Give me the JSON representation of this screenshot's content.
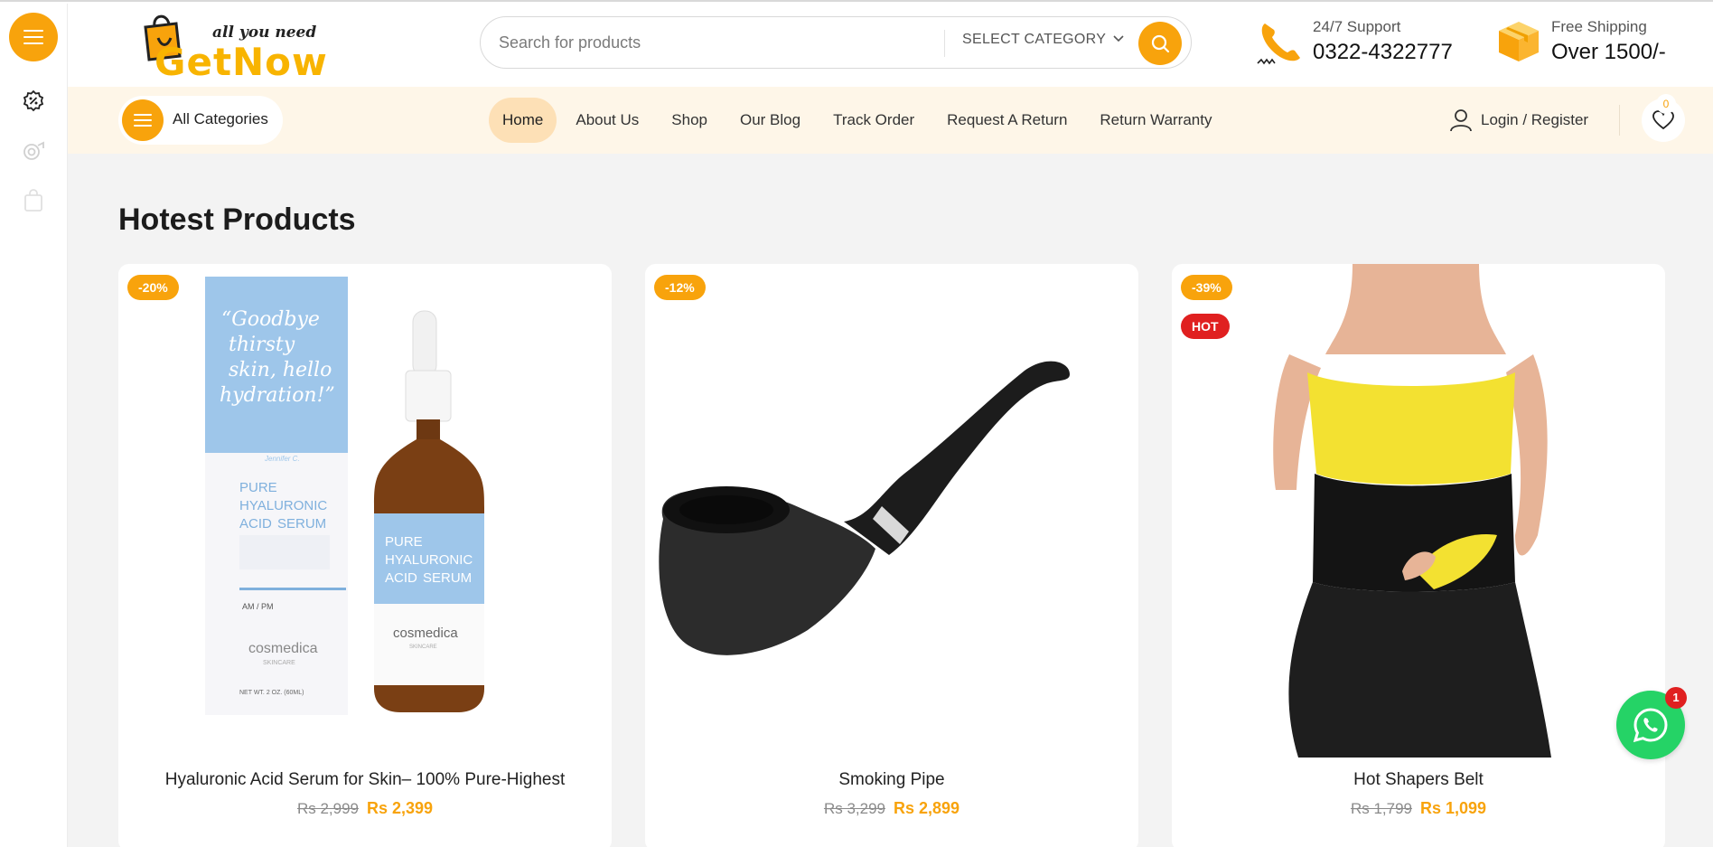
{
  "header": {
    "logo_tagline": "all you need",
    "logo_name": "GetNow",
    "search": {
      "placeholder": "Search for products",
      "category_label": "SELECT CATEGORY"
    },
    "support": {
      "label": "24/7 Support",
      "value": "0322-4322777"
    },
    "shipping": {
      "label": "Free Shipping",
      "value": "Over 1500/-"
    }
  },
  "navbar": {
    "all_categories_label": "All Categories",
    "items": [
      {
        "label": "Home",
        "active": true
      },
      {
        "label": "About Us"
      },
      {
        "label": "Shop"
      },
      {
        "label": "Our Blog"
      },
      {
        "label": "Track Order"
      },
      {
        "label": "Request A Return"
      },
      {
        "label": "Return Warranty"
      }
    ],
    "login_label": "Login / Register",
    "wishlist_count": "0"
  },
  "main": {
    "section_title": "Hotest Products",
    "products": [
      {
        "title": "Hyaluronic Acid Serum for Skin– 100% Pure-Highest",
        "old_price": "Rs 2,999",
        "new_price": "Rs 2,399",
        "discount": "-20%"
      },
      {
        "title": "Smoking Pipe",
        "old_price": "Rs 3,299",
        "new_price": "Rs 2,899",
        "discount": "-12%"
      },
      {
        "title": "Hot Shapers Belt",
        "old_price": "Rs 1,799",
        "new_price": "Rs 1,099",
        "discount": "-39%",
        "hot": "HOT"
      }
    ],
    "serum_box": {
      "quote": "“Goodbye thirsty skin, hello hydration!”",
      "quote_author": "Jennifer C.",
      "line1": "PURE",
      "line2": "HYALURONIC",
      "line3": "ACID",
      "line3b": "SERUM",
      "ampm": "AM / PM",
      "brand": "cosmedica",
      "brand_sub": "SKINCARE",
      "net_wt": "NET WT. 2 OZ. (60ML)"
    }
  },
  "chat": {
    "unread_count": "1"
  },
  "colors": {
    "accent": "#f8a30c",
    "hot": "#e02020",
    "navbar_bg": "#fef6e8",
    "whatsapp": "#25d366"
  },
  "icons": [
    "menu-icon",
    "discount-icon",
    "camera-icon",
    "bag-icon",
    "search-icon",
    "phone-icon",
    "box-icon",
    "user-icon",
    "heart-icon",
    "whatsapp-icon"
  ]
}
